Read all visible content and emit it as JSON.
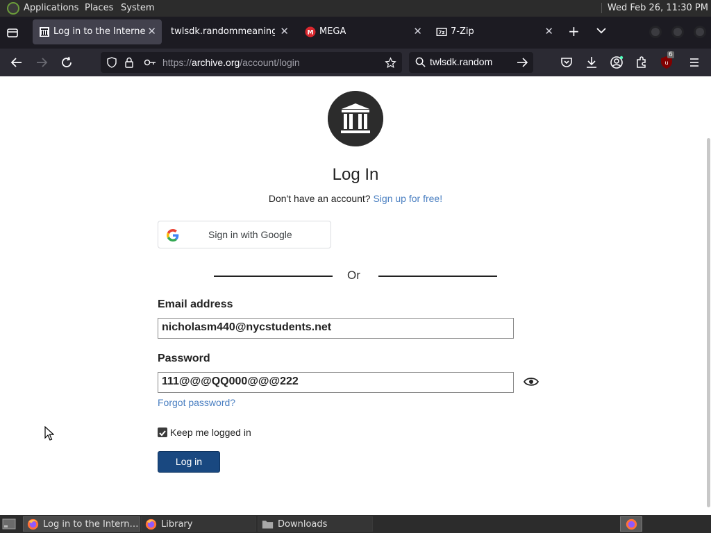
{
  "system_bar": {
    "menus": [
      "Applications",
      "Places",
      "System"
    ],
    "clock": "Wed Feb 26, 11:30 PM"
  },
  "browser": {
    "tabs": [
      {
        "title": "Log in to the Internet A",
        "icon": "archive-icon",
        "active": true
      },
      {
        "title": "twlsdk.randommeaningle",
        "icon": "",
        "active": false
      },
      {
        "title": "MEGA",
        "icon": "mega-icon",
        "active": false
      },
      {
        "title": "7-Zip",
        "icon": "7zip-icon",
        "active": false
      }
    ],
    "url": {
      "prefix": "https://",
      "host": "archive.org",
      "path": "/account/login"
    },
    "search_text": "twlsdk.random",
    "extension_badge": "6"
  },
  "page": {
    "title": "Log In",
    "no_account_text": "Don't have an account?",
    "signup_link": "Sign up for free!",
    "google_button": "Sign in with Google",
    "or_text": "Or",
    "email_label": "Email address",
    "email_value": "nicholasm440@nycstudents.net",
    "password_label": "Password",
    "password_value": "111@@@QQ000@@@222",
    "forgot_password": "Forgot password?",
    "keep_logged_in": "Keep me logged in",
    "keep_logged_in_checked": true,
    "login_button": "Log in"
  },
  "taskbar": {
    "items": [
      {
        "label": "Log in to the Intern…",
        "icon": "firefox-icon",
        "active": true
      },
      {
        "label": "Library",
        "icon": "firefox-icon",
        "active": false
      },
      {
        "label": "Downloads",
        "icon": "folder-icon",
        "active": false
      }
    ]
  },
  "colors": {
    "link": "#4a7fc1",
    "login_button": "#194880",
    "toolbar": "#2b2a33",
    "tabstrip": "#1c1b22"
  }
}
